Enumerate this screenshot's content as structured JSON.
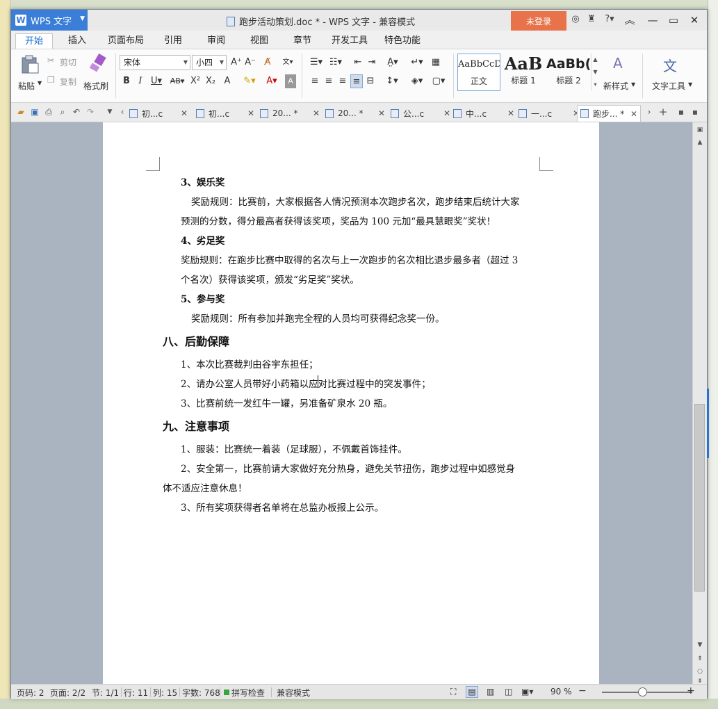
{
  "app": {
    "name": "WPS 文字",
    "title": "跑步活动策划.doc * - WPS 文字 - 兼容模式",
    "login_label": "未登录"
  },
  "menu": {
    "tabs": [
      "开始",
      "插入",
      "页面布局",
      "引用",
      "审阅",
      "视图",
      "章节",
      "开发工具",
      "特色功能"
    ],
    "active_index": 0
  },
  "ribbon": {
    "paste": "粘贴",
    "cut": "剪切",
    "copy": "复制",
    "format_painter": "格式刷",
    "font_name": "宋体",
    "font_size": "小四",
    "styles": [
      {
        "sample": "AaBbCcD",
        "name": "正文"
      },
      {
        "sample": "AaB",
        "name": "标题 1"
      },
      {
        "sample": "AaBb(",
        "name": "标题 2"
      }
    ],
    "new_style": "新样式",
    "text_tools": "文字工具"
  },
  "doc_tabs": [
    {
      "label": "初...c",
      "active": false
    },
    {
      "label": "初...c",
      "active": false
    },
    {
      "label": "20... *",
      "active": false
    },
    {
      "label": "20... *",
      "active": false
    },
    {
      "label": "公...c",
      "active": false
    },
    {
      "label": "中...c",
      "active": false
    },
    {
      "label": "一...c",
      "active": false
    },
    {
      "label": "跑步... *",
      "active": true
    }
  ],
  "document": {
    "s3_title": "3、娱乐奖",
    "s3_l1": "奖励规则：比赛前，大家根据各人情况预测本次跑步名次，跑步结束后统计大家",
    "s3_l2": "预测的分数，得分最高者获得该奖项，奖品为 100 元加“最具慧眼奖”奖状！",
    "s4_title": "4、劣足奖",
    "s4_l1": "奖励规则：在跑步比赛中取得的名次与上一次跑步的名次相比退步最多者（超过 3",
    "s4_l2": "个名次）获得该奖项，颁发“劣足奖”奖状。",
    "s5_title": "5、参与奖",
    "s5_l1": "奖励规则：所有参加并跑完全程的人员均可获得纪念奖一份。",
    "h8": "八、后勤保障",
    "h8_1": "1、本次比赛裁判由谷宇东担任；",
    "h8_2": "2、请办公室人员带好小药箱以应对比赛过程中的突发事件；",
    "h8_3": "3、比赛前统一发红牛一罐，另准备矿泉水 20 瓶。",
    "h9": "九、注意事项",
    "h9_1": "1、服装：比赛统一着装（足球服），不佩戴首饰挂件。",
    "h9_2a": "2、安全第一，比赛前请大家做好充分热身，避免关节扭伤，跑步过程中如感觉身",
    "h9_2b": "体不适应注意休息！",
    "h9_3": "3、所有奖项获得者名单将在总监办板报上公示。"
  },
  "status": {
    "page_code": "页码: 2",
    "pages": "页面: 2/2",
    "section": "节: 1/1",
    "row": "行: 11",
    "col": "列: 15",
    "words": "字数: 768",
    "spell": "拼写检查",
    "compat": "兼容模式",
    "zoom": "90 %",
    "zoom_fraction": 0.45
  }
}
